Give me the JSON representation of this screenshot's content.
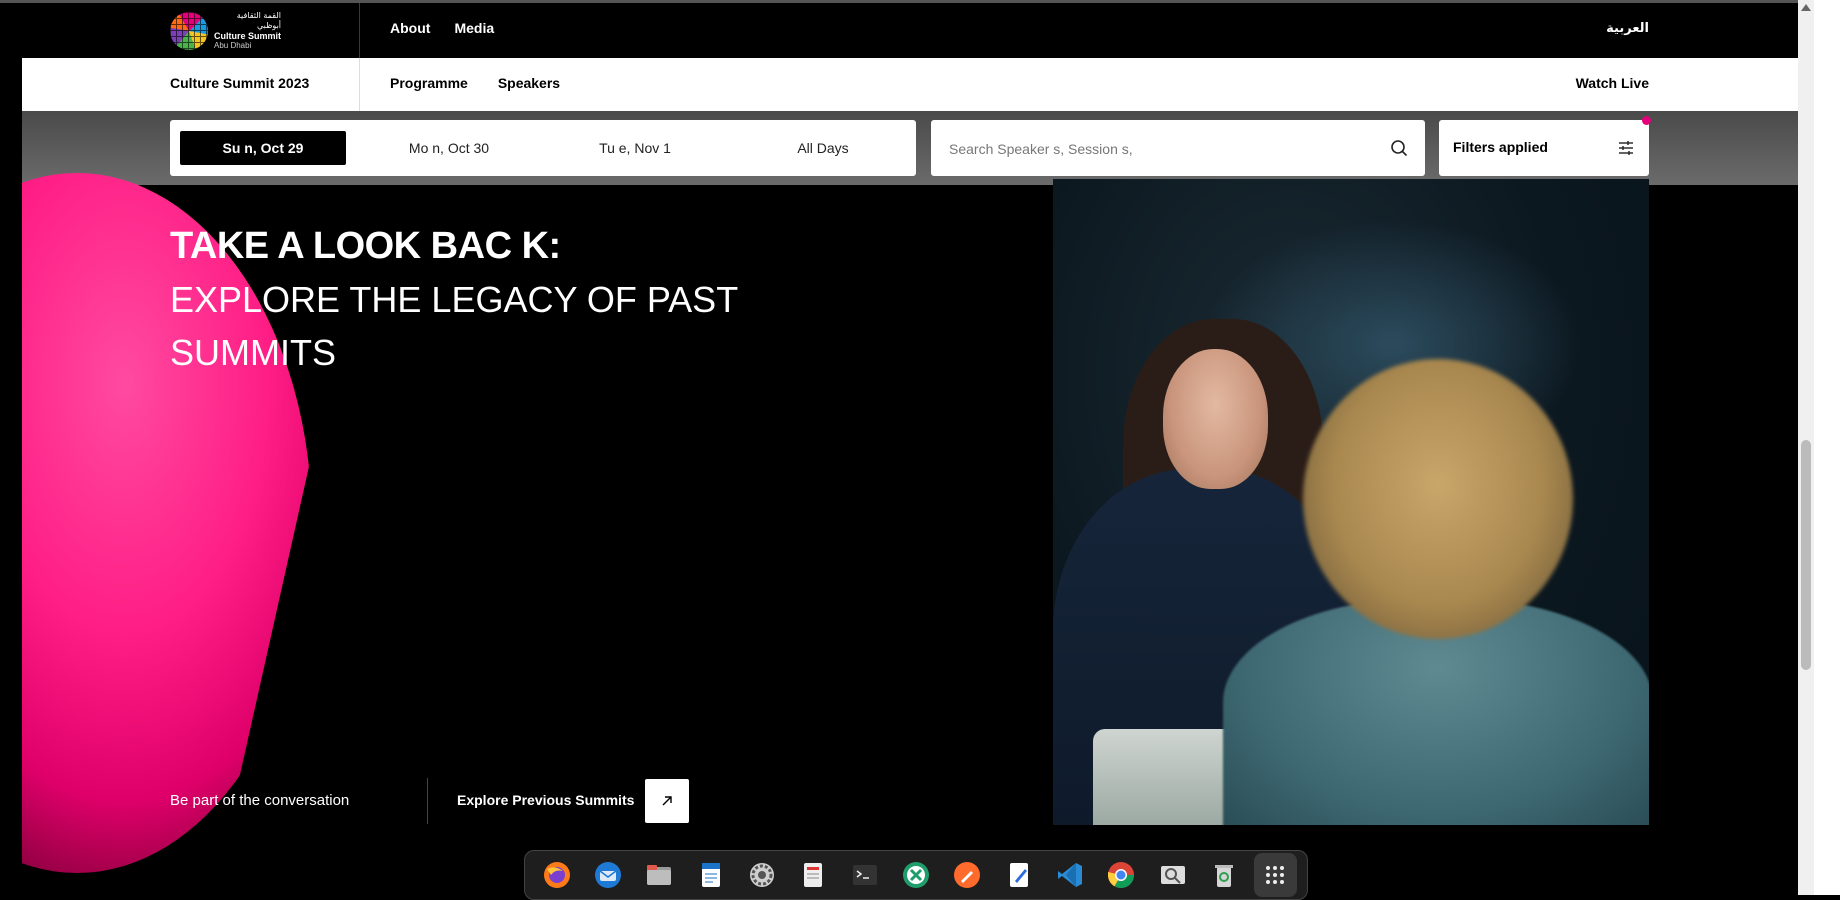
{
  "header": {
    "logo": {
      "arabic_line1": "القمة الثقافية",
      "arabic_line2": "أبوظبي",
      "name": "Culture Summit",
      "city": "Abu Dhabi"
    },
    "nav": [
      "About",
      "Media"
    ],
    "language_link": "العربية"
  },
  "subheader": {
    "brand": "Culture Summit 2023",
    "nav": [
      "Programme",
      "Speakers"
    ],
    "watch_live": "Watch Live"
  },
  "filters": {
    "days": [
      {
        "label": "Su n, Oct 29",
        "active": true
      },
      {
        "label": "Mo n, Oct 30",
        "active": false
      },
      {
        "label": "Tu e, Nov 1",
        "active": false
      },
      {
        "label": "All Days",
        "active": false
      }
    ],
    "search_placeholder": "Search Speaker s, Session s,",
    "filters_label": "Filters applied",
    "indicator_color": "#e4007a"
  },
  "hero": {
    "title": "TAKE A LOOK BAC K:",
    "subtitle": "EXPLORE THE LEGACY OF PAST SUMMITS",
    "tagline": "Be part of the conversation",
    "cta": "Explore Previous Summits"
  },
  "colors": {
    "accent": "#e4007a",
    "background": "#000000"
  },
  "dock": {
    "apps": [
      "firefox-icon",
      "thunderbird-icon",
      "files-icon",
      "writer-icon",
      "settings-icon",
      "document-viewer-icon",
      "terminal-icon",
      "crossover-icon",
      "pen-tool-icon",
      "text-editor-icon",
      "vscode-icon",
      "chrome-icon",
      "image-viewer-icon",
      "trash-icon",
      "app-grid-icon"
    ]
  }
}
